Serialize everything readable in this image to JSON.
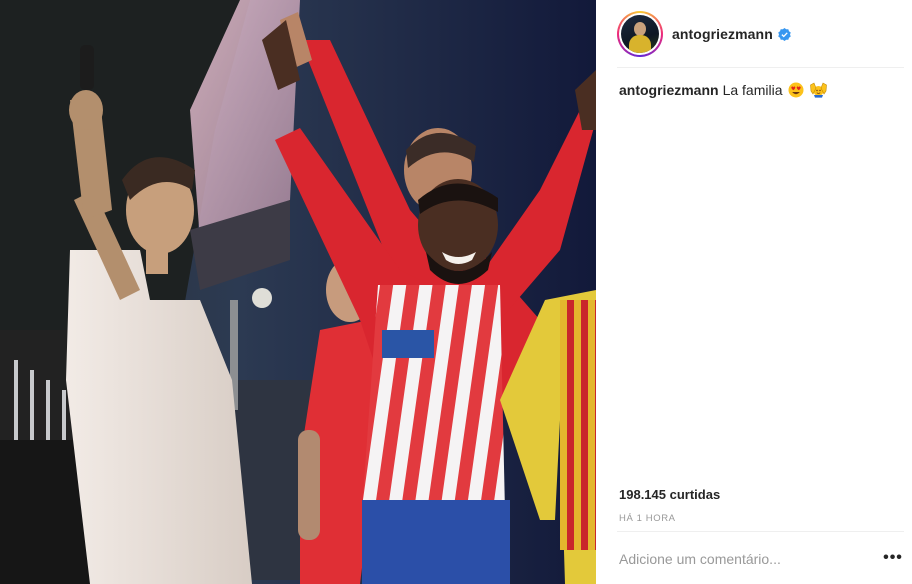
{
  "post": {
    "username": "antogriezmann",
    "verified": true,
    "caption_user": "antogriezmann",
    "caption_text": "La familia",
    "caption_emojis": [
      "heart-eyes-emoji",
      "raising-hands-emoji"
    ],
    "likes": "198.145 curtidas",
    "time": "HÁ 1 HORA"
  },
  "comment_box": {
    "placeholder": "Adicione um comentário...",
    "more_label": "•••"
  },
  "colors": {
    "verified_blue": "#3897f0",
    "text": "#262626",
    "muted": "#999999",
    "divider": "#efefef",
    "atletico_red": "#d9262f"
  }
}
